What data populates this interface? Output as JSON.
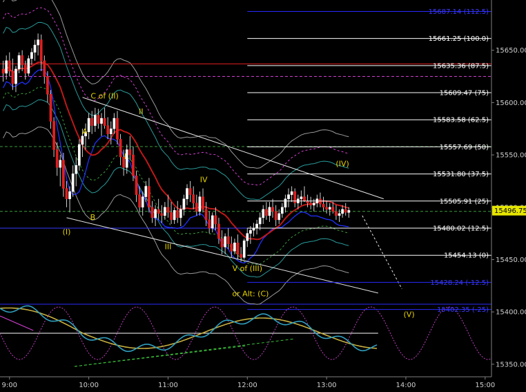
{
  "chart_data": {
    "type": "candlestick",
    "y_axis": {
      "ticks": [
        "15650.00",
        "15600.00",
        "15550.00",
        "15500.00",
        "15450.00",
        "15400.00",
        "15350.00"
      ],
      "tick_values": [
        15650,
        15600,
        15550,
        15500,
        15450,
        15400,
        15350
      ],
      "range": [
        15338,
        15698
      ]
    },
    "x_axis": {
      "ticks": [
        "9:00",
        "10:00",
        "11:00",
        "12:00",
        "13:00",
        "14:00",
        "15:00"
      ],
      "tick_hours": [
        9,
        10,
        11,
        12,
        13,
        14,
        15
      ],
      "range_hours": [
        8.88,
        15.08
      ]
    },
    "current_price": "15496.75",
    "current_value": 15496.75,
    "fib_levels": [
      {
        "label": "15687.14 (112.5)",
        "value": 15687.14,
        "color": "#3a3aff"
      },
      {
        "label": "15661.25 (100.0)",
        "value": 15661.25,
        "color": "#ffffff"
      },
      {
        "label": "15635.36 (87.5)",
        "value": 15635.36,
        "color": "#ffffff"
      },
      {
        "label": "15609.47 (75)",
        "value": 15609.47,
        "color": "#ffffff"
      },
      {
        "label": "15583.58 (62.5)",
        "value": 15583.58,
        "color": "#ffffff"
      },
      {
        "label": "15557.69 (50)",
        "value": 15557.69,
        "color": "#ffffff"
      },
      {
        "label": "15531.80 (37.5)",
        "value": 15531.8,
        "color": "#ffffff"
      },
      {
        "label": "15505.91 (25)",
        "value": 15505.91,
        "color": "#ffffff"
      },
      {
        "label": "15480.02 (12.5)",
        "value": 15480.02,
        "color": "#ffffff"
      },
      {
        "label": "15454.13 (0)",
        "value": 15454.13,
        "color": "#ffffff"
      },
      {
        "label": "15428.24 (-12.5)",
        "value": 15428.24,
        "color": "#3a3aff"
      },
      {
        "label": "15402.35 (-25)",
        "value": 15402.35,
        "color": "#3a3aff"
      }
    ],
    "horizontal_lines": [
      {
        "value": 15637,
        "color": "#e02020",
        "style": "solid"
      },
      {
        "value": 15625,
        "color": "#d040d0",
        "style": "dashed"
      },
      {
        "value": 15480,
        "color": "#3a3aff",
        "style": "solid"
      },
      {
        "value": 15496,
        "color": "#3aa03a",
        "style": "dashed"
      },
      {
        "value": 15558,
        "color": "#3aa03a",
        "style": "dashed"
      }
    ],
    "wave_labels": [
      {
        "text": "C of (II)",
        "t": 10.2,
        "v": 15604
      },
      {
        "text": "II",
        "t": 10.66,
        "v": 15589
      },
      {
        "text": "A",
        "t": 9.95,
        "v": 15570
      },
      {
        "text": "I",
        "t": 10.46,
        "v": 15546
      },
      {
        "text": "IV",
        "t": 11.45,
        "v": 15524
      },
      {
        "text": "(IV)",
        "t": 13.2,
        "v": 15539
      },
      {
        "text": "B",
        "t": 10.05,
        "v": 15488
      },
      {
        "text": "(I)",
        "t": 9.72,
        "v": 15474
      },
      {
        "text": "III",
        "t": 11.0,
        "v": 15460
      },
      {
        "text": "V of (III)",
        "t": 12.0,
        "v": 15439
      },
      {
        "text": "or Alt: (C)",
        "t": 12.04,
        "v": 15415
      },
      {
        "text": "(V)",
        "t": 14.04,
        "v": 15395
      }
    ],
    "candles": [
      [
        8.92,
        15632,
        15640,
        15620,
        15628
      ],
      [
        8.96,
        15628,
        15645,
        15622,
        15640
      ],
      [
        9.0,
        15640,
        15648,
        15625,
        15630
      ],
      [
        9.04,
        15630,
        15642,
        15612,
        15618
      ],
      [
        9.08,
        15618,
        15635,
        15610,
        15632
      ],
      [
        9.12,
        15632,
        15648,
        15628,
        15645
      ],
      [
        9.16,
        15645,
        15650,
        15630,
        15636
      ],
      [
        9.2,
        15636,
        15640,
        15622,
        15628
      ],
      [
        9.24,
        15628,
        15645,
        15625,
        15642
      ],
      [
        9.28,
        15642,
        15652,
        15636,
        15648
      ],
      [
        9.32,
        15648,
        15660,
        15640,
        15655
      ],
      [
        9.36,
        15655,
        15666,
        15645,
        15660
      ],
      [
        9.4,
        15660,
        15665,
        15630,
        15640
      ],
      [
        9.44,
        15640,
        15645,
        15618,
        15625
      ],
      [
        9.48,
        15625,
        15630,
        15600,
        15608
      ],
      [
        9.52,
        15608,
        15612,
        15575,
        15582
      ],
      [
        9.56,
        15582,
        15586,
        15548,
        15555
      ],
      [
        9.6,
        15555,
        15562,
        15530,
        15538
      ],
      [
        9.64,
        15538,
        15550,
        15520,
        15545
      ],
      [
        9.68,
        15545,
        15552,
        15510,
        15518
      ],
      [
        9.72,
        15518,
        15525,
        15500,
        15508
      ],
      [
        9.76,
        15508,
        15520,
        15495,
        15515
      ],
      [
        9.8,
        15515,
        15540,
        15510,
        15532
      ],
      [
        9.84,
        15532,
        15548,
        15520,
        15540
      ],
      [
        9.88,
        15540,
        15565,
        15535,
        15560
      ],
      [
        9.92,
        15560,
        15575,
        15548,
        15568
      ],
      [
        9.96,
        15568,
        15580,
        15555,
        15572
      ],
      [
        10.0,
        15572,
        15590,
        15565,
        15585
      ],
      [
        10.04,
        15585,
        15592,
        15570,
        15578
      ],
      [
        10.08,
        15578,
        15595,
        15572,
        15588
      ],
      [
        10.12,
        15588,
        15594,
        15575,
        15580
      ],
      [
        10.16,
        15580,
        15590,
        15568,
        15585
      ],
      [
        10.2,
        15585,
        15595,
        15575,
        15578
      ],
      [
        10.24,
        15578,
        15586,
        15565,
        15570
      ],
      [
        10.28,
        15570,
        15582,
        15560,
        15575
      ],
      [
        10.32,
        15575,
        15590,
        15570,
        15585
      ],
      [
        10.36,
        15585,
        15592,
        15560,
        15565
      ],
      [
        10.4,
        15565,
        15570,
        15540,
        15548
      ],
      [
        10.44,
        15548,
        15555,
        15530,
        15538
      ],
      [
        10.48,
        15538,
        15560,
        15532,
        15555
      ],
      [
        10.52,
        15555,
        15568,
        15545,
        15550
      ],
      [
        10.56,
        15550,
        15558,
        15525,
        15530
      ],
      [
        10.6,
        15530,
        15535,
        15505,
        15512
      ],
      [
        10.64,
        15512,
        15520,
        15495,
        15500
      ],
      [
        10.68,
        15500,
        15515,
        15492,
        15510
      ],
      [
        10.72,
        15510,
        15525,
        15505,
        15520
      ],
      [
        10.76,
        15520,
        15528,
        15495,
        15500
      ],
      [
        10.8,
        15500,
        15506,
        15485,
        15490
      ],
      [
        10.84,
        15490,
        15502,
        15482,
        15498
      ],
      [
        10.88,
        15498,
        15508,
        15488,
        15494
      ],
      [
        10.92,
        15494,
        15502,
        15485,
        15492
      ],
      [
        10.96,
        15492,
        15505,
        15488,
        15500
      ],
      [
        11.0,
        15500,
        15512,
        15490,
        15495
      ],
      [
        11.04,
        15495,
        15505,
        15484,
        15488
      ],
      [
        11.08,
        15488,
        15500,
        15484,
        15497
      ],
      [
        11.12,
        15497,
        15506,
        15485,
        15490
      ],
      [
        11.16,
        15490,
        15502,
        15482,
        15498
      ],
      [
        11.2,
        15498,
        15512,
        15492,
        15508
      ],
      [
        11.24,
        15508,
        15522,
        15502,
        15518
      ],
      [
        11.28,
        15518,
        15525,
        15505,
        15512
      ],
      [
        11.32,
        15512,
        15520,
        15498,
        15504
      ],
      [
        11.36,
        15504,
        15512,
        15492,
        15496
      ],
      [
        11.4,
        15496,
        15515,
        15492,
        15510
      ],
      [
        11.44,
        15510,
        15518,
        15495,
        15498
      ],
      [
        11.48,
        15498,
        15505,
        15482,
        15488
      ],
      [
        11.52,
        15488,
        15496,
        15475,
        15480
      ],
      [
        11.56,
        15480,
        15495,
        15476,
        15492
      ],
      [
        11.6,
        15492,
        15500,
        15478,
        15484
      ],
      [
        11.64,
        15484,
        15490,
        15465,
        15470
      ],
      [
        11.68,
        15470,
        15478,
        15455,
        15462
      ],
      [
        11.72,
        15462,
        15475,
        15455,
        15472
      ],
      [
        11.76,
        15472,
        15480,
        15460,
        15465
      ],
      [
        11.8,
        15465,
        15472,
        15452,
        15458
      ],
      [
        11.84,
        15458,
        15470,
        15455,
        15466
      ],
      [
        11.88,
        15466,
        15474,
        15450,
        15455
      ],
      [
        11.92,
        15455,
        15462,
        15448,
        15452
      ],
      [
        11.96,
        15452,
        15470,
        15450,
        15468
      ],
      [
        12.0,
        15468,
        15480,
        15462,
        15475
      ],
      [
        12.04,
        15475,
        15482,
        15465,
        15478
      ],
      [
        12.08,
        15478,
        15485,
        15472,
        15480
      ],
      [
        12.12,
        15480,
        15488,
        15474,
        15484
      ],
      [
        12.16,
        15484,
        15495,
        15478,
        15490
      ],
      [
        12.2,
        15490,
        15502,
        15484,
        15498
      ],
      [
        12.24,
        15498,
        15505,
        15488,
        15492
      ],
      [
        12.28,
        15492,
        15505,
        15486,
        15500
      ],
      [
        12.32,
        15500,
        15508,
        15490,
        15496
      ],
      [
        12.36,
        15496,
        15502,
        15482,
        15488
      ],
      [
        12.4,
        15488,
        15498,
        15484,
        15494
      ],
      [
        12.44,
        15494,
        15504,
        15490,
        15500
      ],
      [
        12.48,
        15500,
        15512,
        15495,
        15508
      ],
      [
        12.52,
        15508,
        15518,
        15500,
        15512
      ],
      [
        12.56,
        15512,
        15520,
        15505,
        15515
      ],
      [
        12.6,
        15515,
        15518,
        15500,
        15504
      ],
      [
        12.64,
        15504,
        15512,
        15498,
        15508
      ],
      [
        12.68,
        15508,
        15516,
        15502,
        15510
      ],
      [
        12.72,
        15510,
        15520,
        15505,
        15506
      ],
      [
        12.76,
        15506,
        15512,
        15500,
        15504
      ],
      [
        12.8,
        15504,
        15510,
        15498,
        15502
      ],
      [
        12.84,
        15502,
        15508,
        15496,
        15504
      ],
      [
        12.88,
        15504,
        15512,
        15500,
        15508
      ],
      [
        12.92,
        15508,
        15514,
        15500,
        15503
      ],
      [
        12.96,
        15503,
        15510,
        15496,
        15500
      ],
      [
        13.0,
        15500,
        15506,
        15494,
        15498
      ],
      [
        13.04,
        15498,
        15504,
        15492,
        15500
      ],
      [
        13.08,
        15500,
        15505,
        15494,
        15496
      ],
      [
        13.12,
        15496,
        15502,
        15488,
        15492
      ],
      [
        13.16,
        15492,
        15498,
        15486,
        15494
      ],
      [
        13.2,
        15494,
        15502,
        15490,
        15498
      ],
      [
        13.24,
        15498,
        15504,
        15492,
        15495
      ],
      [
        13.28,
        15495,
        15500,
        15490,
        15497
      ]
    ]
  }
}
